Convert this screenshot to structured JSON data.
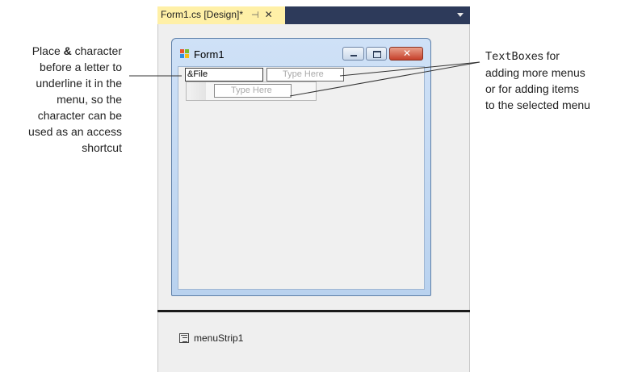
{
  "tab": {
    "title": "Form1.cs [Design]*",
    "pin_glyph": "⊣",
    "close_glyph": "✕"
  },
  "form": {
    "title": "Form1",
    "caption_close_glyph": "✕"
  },
  "menu": {
    "first_item_value": "&File",
    "type_here_top": "Type Here",
    "type_here_sub": "Type Here"
  },
  "tray": {
    "component_name": "menuStrip1"
  },
  "callouts": {
    "left": {
      "line1_pre": "Place ",
      "line1_bold": "&",
      "line1_post": " character",
      "line2": "before a letter to",
      "line3": "underline it in the",
      "line4": "menu, so the",
      "line5": "character can be",
      "line6": "used as an access",
      "line7": "shortcut"
    },
    "right": {
      "mono": "TextBox",
      "line1_post": "es for",
      "line2": "adding more menus",
      "line3": "or for adding items",
      "line4": "to the selected menu"
    }
  },
  "colors": {
    "tab_active": "#fff0a7",
    "tab_strip": "#2d3a5a",
    "design_surface": "#efefef",
    "form_frame": "#cfe1f7",
    "caption_close": "#c6402a"
  },
  "icons": {
    "form_icon": "windows-form-icon",
    "tray_icon": "menustrip-icon",
    "pin_icon": "pin-icon",
    "tab_close_icon": "close-icon",
    "minimize_icon": "minimize-icon",
    "maximize_icon": "maximize-icon",
    "close_icon": "close-icon"
  }
}
